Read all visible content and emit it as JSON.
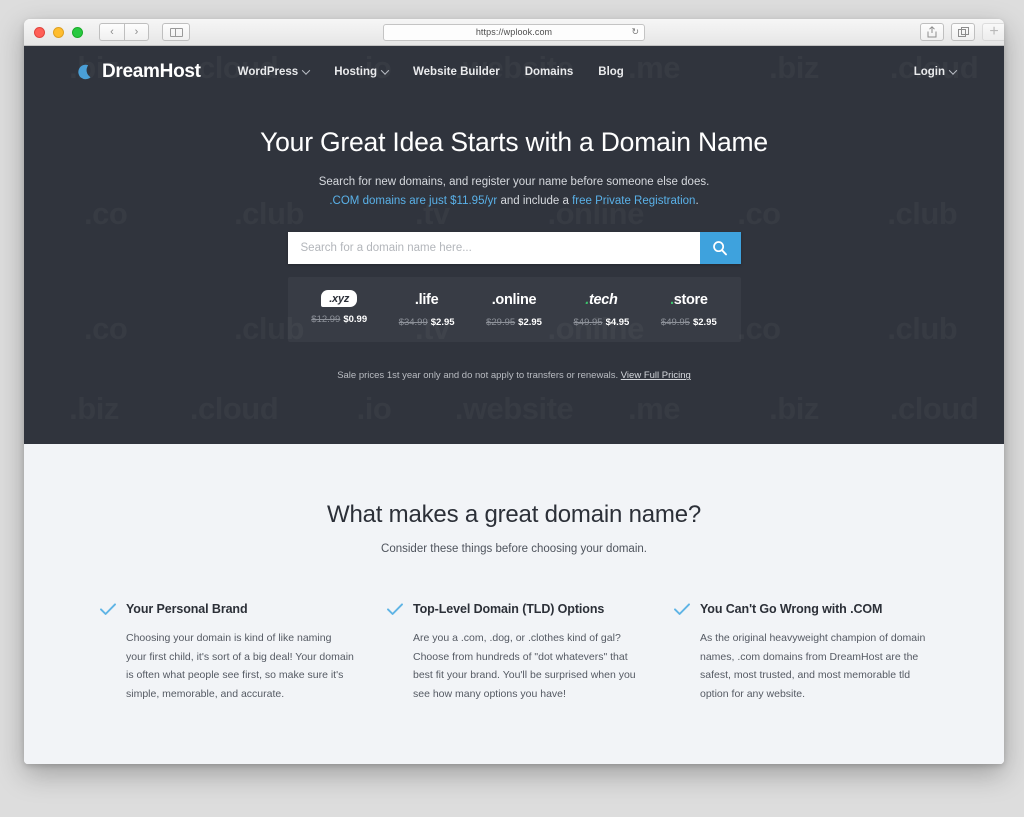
{
  "browser": {
    "url": "https://wplook.com",
    "reload_icon": "reload-icon",
    "back_icon": "‹",
    "forward_icon": "›",
    "sidebar_icon": "sidebar-icon",
    "share_icon": "share-icon",
    "tabs_icon": "tabs-icon",
    "new_tab_icon": "+"
  },
  "site": {
    "brand": "DreamHost",
    "nav": [
      {
        "label": "WordPress",
        "has_chevron": true
      },
      {
        "label": "Hosting",
        "has_chevron": true
      },
      {
        "label": "Website Builder",
        "has_chevron": false
      },
      {
        "label": "Domains",
        "has_chevron": false
      },
      {
        "label": "Blog",
        "has_chevron": false
      }
    ],
    "login": {
      "label": "Login",
      "has_chevron": true
    }
  },
  "hero": {
    "title": "Your Great Idea Starts with a Domain Name",
    "sub_line1": "Search for new domains, and register your name before someone else does.",
    "sub_link1": ".COM domains are just $11.95/yr",
    "sub_mid": " and include a ",
    "sub_link2": "free Private Registration",
    "sub_end": ".",
    "search": {
      "placeholder": "Search for a domain name here...",
      "value": "",
      "button_icon": "search-icon"
    },
    "tlds": [
      {
        "name": ".xyz",
        "style": "badge",
        "old_price": "$12.99",
        "new_price": "$0.99"
      },
      {
        "name": ".life",
        "style": "plain",
        "old_price": "$34.99",
        "new_price": "$2.95"
      },
      {
        "name": ".online",
        "style": "plain",
        "old_price": "$29.95",
        "new_price": "$2.95"
      },
      {
        "name": ".tech",
        "style": "greendot-italic",
        "old_price": "$49.95",
        "new_price": "$4.95"
      },
      {
        "name": "store",
        "style": "greendot",
        "old_price": "$49.95",
        "new_price": "$2.95"
      }
    ],
    "disclaimer_text": "Sale prices 1st year only and do not apply to transfers or renewals. ",
    "disclaimer_link": "View Full Pricing",
    "watermarks_row1": [
      ".biz",
      ".cloud",
      ".io",
      ".website",
      ".me",
      ".biz",
      ".cloud"
    ],
    "watermarks_row2": [
      ".co",
      ".club",
      ".tv",
      ".online",
      ".co",
      ".club"
    ],
    "watermarks_row3": [
      ".biz",
      ".cloud",
      ".io",
      ".website",
      ".me",
      ".biz",
      ".cloud"
    ]
  },
  "features": {
    "title": "What makes a great domain name?",
    "subtitle": "Consider these things before choosing your domain.",
    "columns": [
      {
        "check_icon": "check-icon",
        "title": "Your Personal Brand",
        "text": "Choosing your domain is kind of like naming your first child, it's sort of a big deal! Your domain is often what people see first, so make sure it's simple, memorable, and accurate."
      },
      {
        "check_icon": "check-icon",
        "title": "Top-Level Domain (TLD) Options",
        "text": "Are you a .com, .dog, or .clothes kind of gal? Choose from hundreds of \"dot whatevers\" that best fit your brand. You'll be surprised when you see how many options you have!"
      },
      {
        "check_icon": "check-icon",
        "title": "You Can't Go Wrong with .COM",
        "text": "As the original heavyweight champion of domain names, .com domains from DreamHost are the safest, most trusted, and most memorable tld option for any website."
      }
    ]
  },
  "colors": {
    "hero_bg": "#30343d",
    "accent_blue": "#3ea2dd",
    "link_blue": "#5ab1e8",
    "light_bg": "#f2f4f7",
    "green": "#3cbf6b"
  }
}
